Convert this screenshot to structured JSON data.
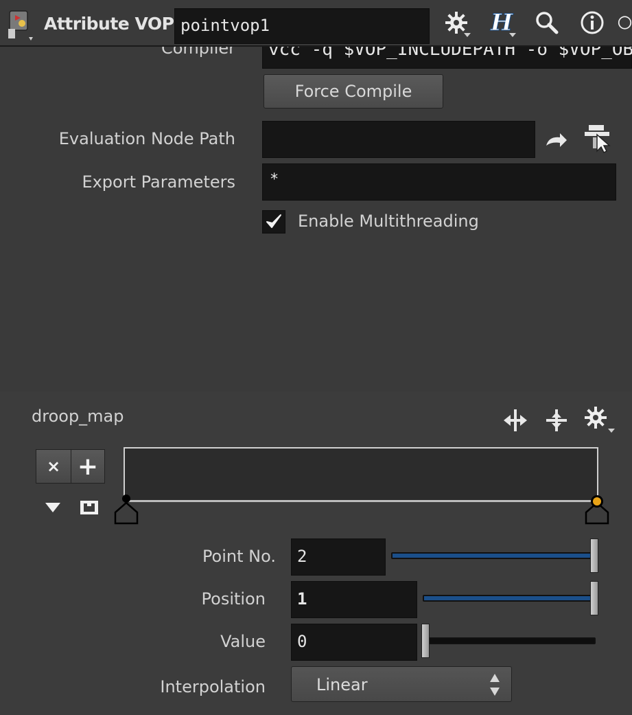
{
  "header": {
    "node_type": "Attribute VOP",
    "node_name": "pointvop1",
    "icons": [
      "vop-node-icon",
      "gear-icon",
      "houdini-help-icon",
      "search-icon",
      "info-icon",
      "clock-icon"
    ]
  },
  "params": {
    "compiler_label": "Compiler",
    "compiler_value": "vcc -q $VOP_INCLUDEPATH -o $VOP_OBJECTFILE",
    "force_compile_label": "Force Compile",
    "eval_node_path_label": "Evaluation Node Path",
    "eval_node_path_value": "",
    "export_params_label": "Export Parameters",
    "export_params_value": "*",
    "multithreading_label": "Enable Multithreading",
    "multithreading_checked": true
  },
  "ramp": {
    "name": "droop_map",
    "remove_point_label": "×",
    "add_point_label": "+",
    "point_no_label": "Point No.",
    "point_no_value": "2",
    "point_no_fraction": 1.0,
    "position_label": "Position",
    "position_value": "1",
    "position_fraction": 1.0,
    "value_label": "Value",
    "value_value": "0",
    "value_fraction": 0.0,
    "interpolation_label": "Interpolation",
    "interpolation_value": "Linear"
  },
  "colors": {
    "accent_blue": "#1b4f8a",
    "selected_key": "#e8a317"
  }
}
